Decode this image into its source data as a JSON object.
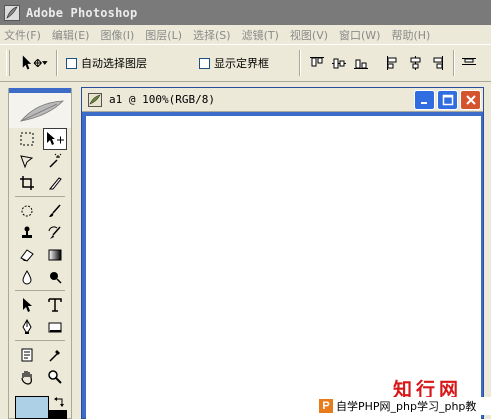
{
  "app": {
    "title": "Adobe Photoshop"
  },
  "menu": [
    {
      "label": "文件(F)"
    },
    {
      "label": "编辑(E)"
    },
    {
      "label": "图像(I)"
    },
    {
      "label": "图层(L)"
    },
    {
      "label": "选择(S)"
    },
    {
      "label": "滤镜(T)"
    },
    {
      "label": "视图(V)"
    },
    {
      "label": "窗口(W)"
    },
    {
      "label": "帮助(H)"
    }
  ],
  "options": {
    "auto_select_layer": {
      "label": "自动选择图层",
      "checked": false
    },
    "show_bounding_box": {
      "label": "显示定界框",
      "checked": false
    }
  },
  "toolbox": {
    "tools": [
      "marquee-tool",
      "move-tool",
      "lasso-tool",
      "magic-wand-tool",
      "crop-tool",
      "slice-tool",
      "healing-brush-tool",
      "brush-tool",
      "clone-stamp-tool",
      "history-brush-tool",
      "eraser-tool",
      "gradient-tool",
      "blur-tool",
      "dodge-tool",
      "path-selection-tool",
      "type-tool",
      "pen-tool",
      "shape-tool",
      "notes-tool",
      "eyedropper-tool",
      "hand-tool",
      "zoom-tool"
    ],
    "active_tool": "move-tool",
    "foreground_color": "#aed0e6",
    "background_color": "#000000"
  },
  "document": {
    "title": "a1 @ 100%(RGB/8)"
  },
  "watermark": {
    "logo": "知行网",
    "badge_icon": "P",
    "badge_text": "自学PHP网_php学习_php教"
  },
  "colors": {
    "titlebar": "#7a7a7a",
    "accent_blue": "#3c6bc8",
    "close_red": "#d4542f",
    "watermark_red": "#d81818"
  }
}
